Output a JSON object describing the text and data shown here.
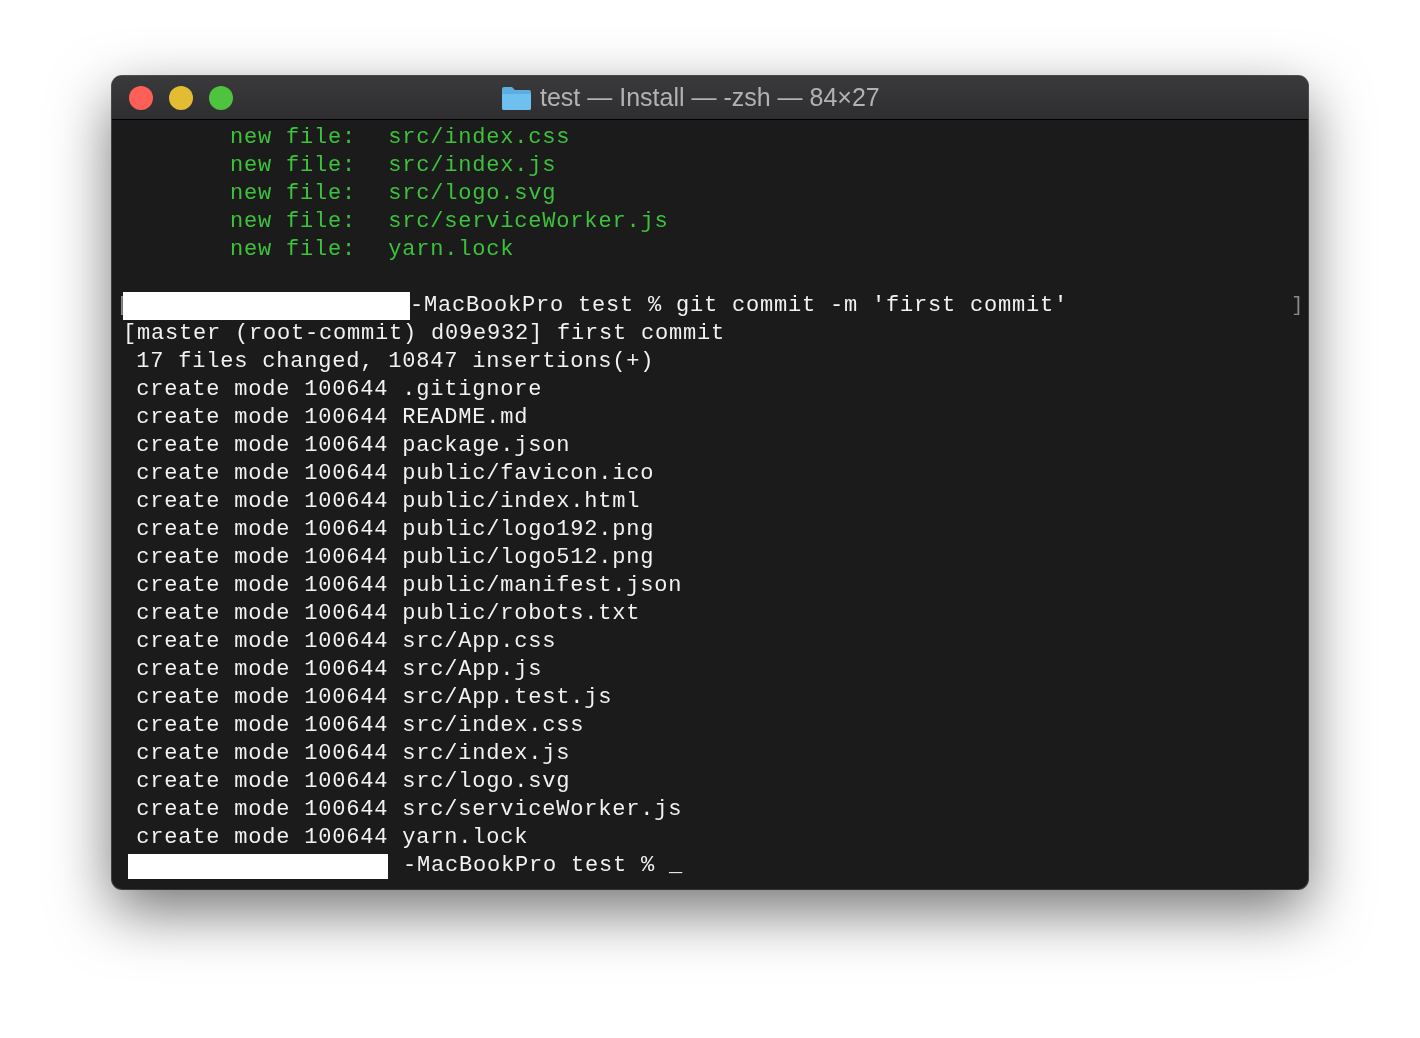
{
  "window": {
    "title": "test — Install — -zsh — 84×27"
  },
  "lines": [
    {
      "kind": "staged",
      "status": "new file:",
      "path": "src/index.css"
    },
    {
      "kind": "staged",
      "status": "new file:",
      "path": "src/index.js"
    },
    {
      "kind": "staged",
      "status": "new file:",
      "path": "src/logo.svg"
    },
    {
      "kind": "staged",
      "status": "new file:",
      "path": "src/serviceWorker.js"
    },
    {
      "kind": "staged",
      "status": "new file:",
      "path": "yarn.lock"
    },
    {
      "kind": "blank"
    },
    {
      "kind": "prompt",
      "text": "-MacBookPro test % git commit -m 'first commit'",
      "mark_left": "[",
      "mark_right": "]"
    },
    {
      "kind": "output",
      "text": "[master (root-commit) d09e932] first commit"
    },
    {
      "kind": "detail",
      "text": "17 files changed, 10847 insertions(+)"
    },
    {
      "kind": "detail",
      "text": "create mode 100644 .gitignore"
    },
    {
      "kind": "detail",
      "text": "create mode 100644 README.md"
    },
    {
      "kind": "detail",
      "text": "create mode 100644 package.json"
    },
    {
      "kind": "detail",
      "text": "create mode 100644 public/favicon.ico"
    },
    {
      "kind": "detail",
      "text": "create mode 100644 public/index.html"
    },
    {
      "kind": "detail",
      "text": "create mode 100644 public/logo192.png"
    },
    {
      "kind": "detail",
      "text": "create mode 100644 public/logo512.png"
    },
    {
      "kind": "detail",
      "text": "create mode 100644 public/manifest.json"
    },
    {
      "kind": "detail",
      "text": "create mode 100644 public/robots.txt"
    },
    {
      "kind": "detail",
      "text": "create mode 100644 src/App.css"
    },
    {
      "kind": "detail",
      "text": "create mode 100644 src/App.js"
    },
    {
      "kind": "detail",
      "text": "create mode 100644 src/App.test.js"
    },
    {
      "kind": "detail",
      "text": "create mode 100644 src/index.css"
    },
    {
      "kind": "detail",
      "text": "create mode 100644 src/index.js"
    },
    {
      "kind": "detail",
      "text": "create mode 100644 src/logo.svg"
    },
    {
      "kind": "detail",
      "text": "create mode 100644 src/serviceWorker.js"
    },
    {
      "kind": "detail",
      "text": "create mode 100644 yarn.lock"
    },
    {
      "kind": "prompt",
      "text": "-MacBookPro test % ",
      "cursor": "_"
    }
  ]
}
